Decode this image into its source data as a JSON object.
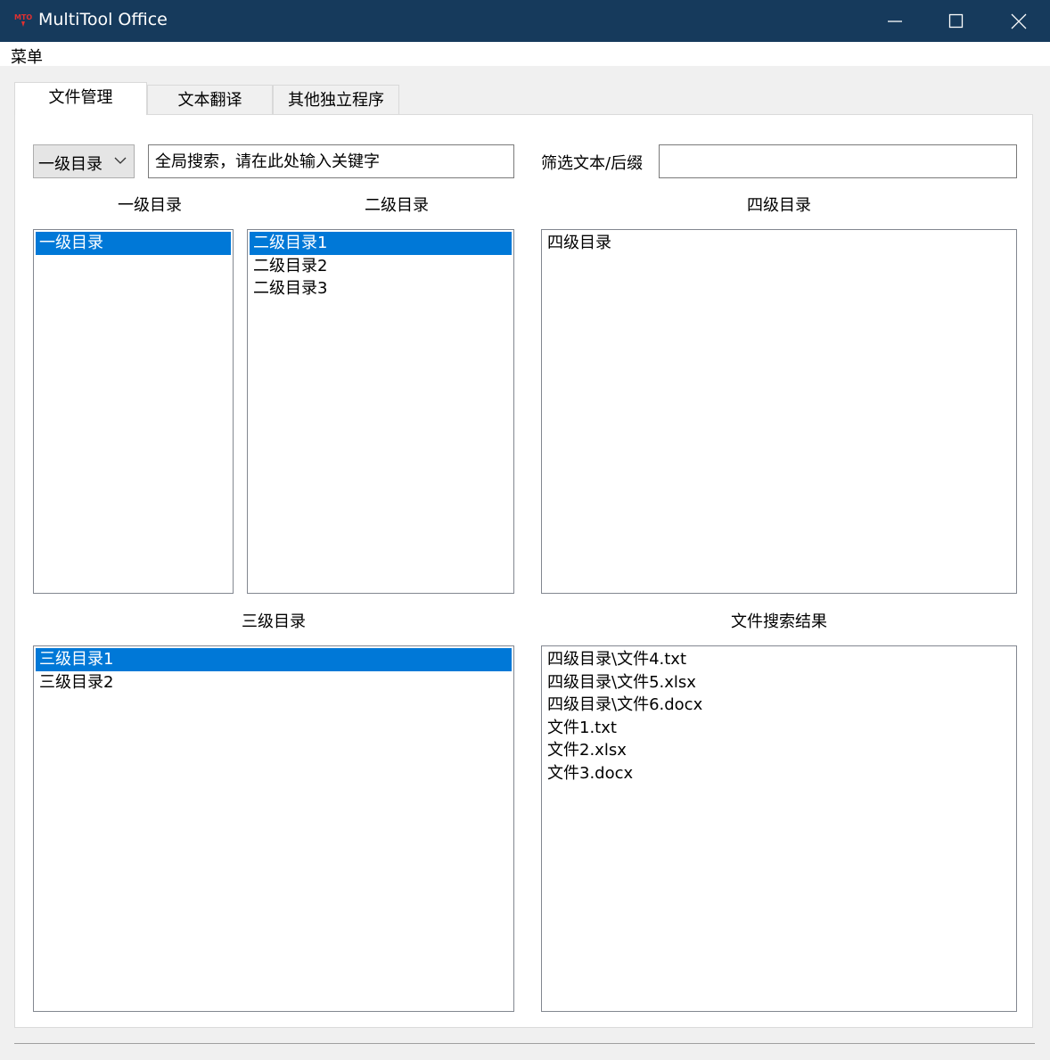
{
  "window": {
    "title": "MultiTool Office",
    "titlebar_color": "#163a5c",
    "selection_color": "#0078d7",
    "controls": [
      "minimize-icon",
      "maximize-icon",
      "close-icon"
    ]
  },
  "menubar": {
    "menu_label": "菜单"
  },
  "tabs": [
    {
      "label": "文件管理",
      "active": true
    },
    {
      "label": "文本翻译",
      "active": false
    },
    {
      "label": "其他独立程序",
      "active": false
    }
  ],
  "toolbar": {
    "level_select_value": "一级目录",
    "global_search_placeholder": "全局搜索，请在此处输入关键字",
    "filter_label": "筛选文本/后缀",
    "filter_value": ""
  },
  "lists": {
    "level1": {
      "label": "一级目录",
      "items": [
        "一级目录"
      ],
      "selected": 0
    },
    "level2": {
      "label": "二级目录",
      "items": [
        "二级目录1",
        "二级目录2",
        "二级目录3"
      ],
      "selected": 0
    },
    "level4": {
      "label": "四级目录",
      "items": [
        "四级目录"
      ],
      "selected": null
    },
    "level3": {
      "label": "三级目录",
      "items": [
        "三级目录1",
        "三级目录2"
      ],
      "selected": 0
    },
    "results": {
      "label": "文件搜索结果",
      "items": [
        "四级目录\\文件4.txt",
        "四级目录\\文件5.xlsx",
        "四级目录\\文件6.docx",
        "文件1.txt",
        "文件2.xlsx",
        "文件3.docx"
      ],
      "selected": null
    }
  }
}
